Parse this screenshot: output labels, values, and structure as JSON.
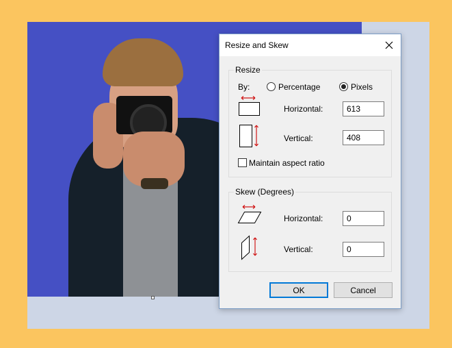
{
  "dialog": {
    "title": "Resize and Skew",
    "close_icon": "close-icon"
  },
  "resize": {
    "group_title": "Resize",
    "by_label": "By:",
    "option_percentage": "Percentage",
    "option_pixels": "Pixels",
    "selected_option": "Pixels",
    "horizontal_label": "Horizontal:",
    "horizontal_value": "613",
    "vertical_label": "Vertical:",
    "vertical_value": "408",
    "maintain_label": "Maintain aspect ratio",
    "maintain_checked": false
  },
  "skew": {
    "group_title": "Skew (Degrees)",
    "horizontal_label": "Horizontal:",
    "horizontal_value": "0",
    "vertical_label": "Vertical:",
    "vertical_value": "0"
  },
  "buttons": {
    "ok": "OK",
    "cancel": "Cancel"
  },
  "colors": {
    "page_background": "#fbc55f",
    "canvas_background": "#cdd6e6",
    "image_background": "#4550c4",
    "arrow_red": "#d01818"
  }
}
